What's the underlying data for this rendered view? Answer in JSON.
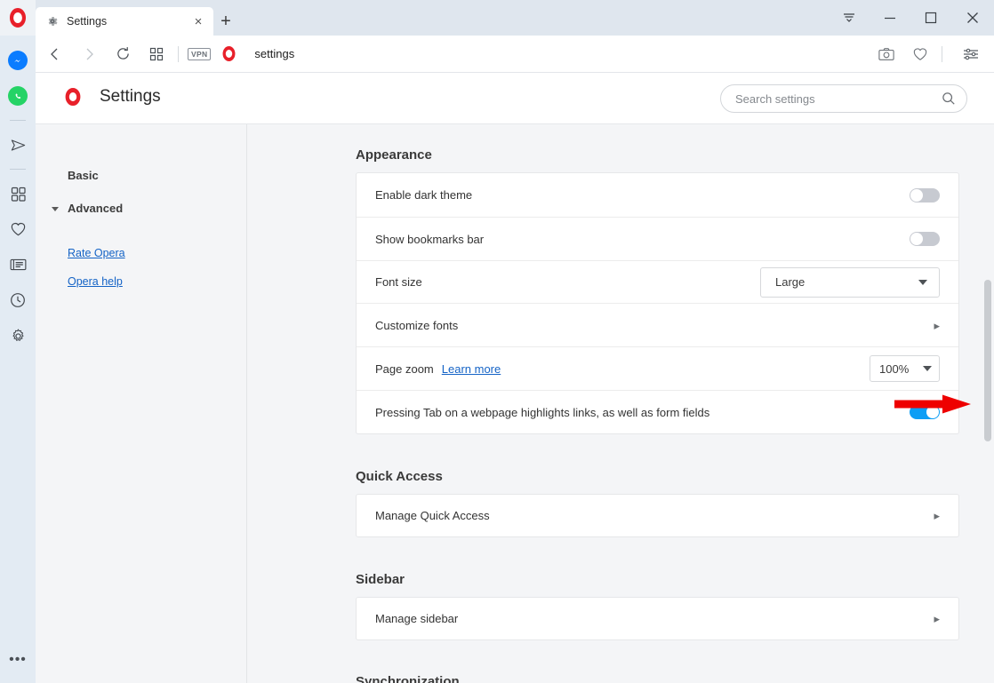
{
  "window": {
    "tab": {
      "title": "Settings",
      "icon": "gear-icon",
      "close_label": "×"
    },
    "new_tab_label": "+",
    "controls": {
      "menu_label": "list-chevron-down-icon",
      "minimize_label": "minimize-icon",
      "maximize_label": "maximize-icon",
      "close_label": "close-icon"
    }
  },
  "addressbar": {
    "back": "back-icon",
    "forward": "forward-icon",
    "reload": "reload-icon",
    "speeddial": "speed-dial-icon",
    "vpn_label": "VPN",
    "url": "settings",
    "snapshot": "camera-icon",
    "heart": "heart-icon",
    "easy_setup": "easy-setup-icon"
  },
  "app_sidebar": {
    "items": [
      {
        "name": "messenger",
        "label": "Messenger"
      },
      {
        "name": "whatsapp",
        "label": "WhatsApp"
      },
      {
        "name": "telegram",
        "label": "Telegram"
      },
      {
        "name": "workspaces",
        "label": "Workspaces"
      },
      {
        "name": "favorites",
        "label": "Favorites"
      },
      {
        "name": "news",
        "label": "News"
      },
      {
        "name": "history",
        "label": "History"
      },
      {
        "name": "settings",
        "label": "Settings"
      }
    ],
    "more_label": "•••"
  },
  "header": {
    "title": "Settings",
    "brand_icon": "opera-logo-icon"
  },
  "search": {
    "placeholder": "Search settings",
    "value": "",
    "icon": "search-icon"
  },
  "nav": {
    "basic_label": "Basic",
    "advanced_label": "Advanced",
    "links": [
      {
        "label": "Rate Opera"
      },
      {
        "label": "Opera help"
      }
    ]
  },
  "sections": [
    {
      "title": "Appearance",
      "rows": [
        {
          "label": "Enable dark theme",
          "control": "toggle",
          "state": "off"
        },
        {
          "label": "Show bookmarks bar",
          "control": "toggle",
          "state": "off"
        },
        {
          "label": "Font size",
          "control": "select",
          "value": "Large",
          "annotated": true
        },
        {
          "label": "Customize fonts",
          "control": "chevron",
          "chevron": "▸"
        },
        {
          "label": "Page zoom",
          "link": "Learn more",
          "control": "select-small",
          "value": "100%"
        },
        {
          "label": "Pressing Tab on a webpage highlights links, as well as form fields",
          "control": "toggle",
          "state": "on"
        }
      ]
    },
    {
      "title": "Quick Access",
      "rows": [
        {
          "label": "Manage Quick Access",
          "control": "chevron",
          "chevron": "▸"
        }
      ]
    },
    {
      "title": "Sidebar",
      "rows": [
        {
          "label": "Manage sidebar",
          "control": "chevron",
          "chevron": "▸"
        }
      ]
    },
    {
      "title": "Synchronization",
      "rows": []
    }
  ],
  "colors": {
    "accent_blue": "#0d9ef5",
    "opera_red": "#e8202a",
    "link_blue": "#1463c6",
    "annotation_red": "#ee0000"
  }
}
